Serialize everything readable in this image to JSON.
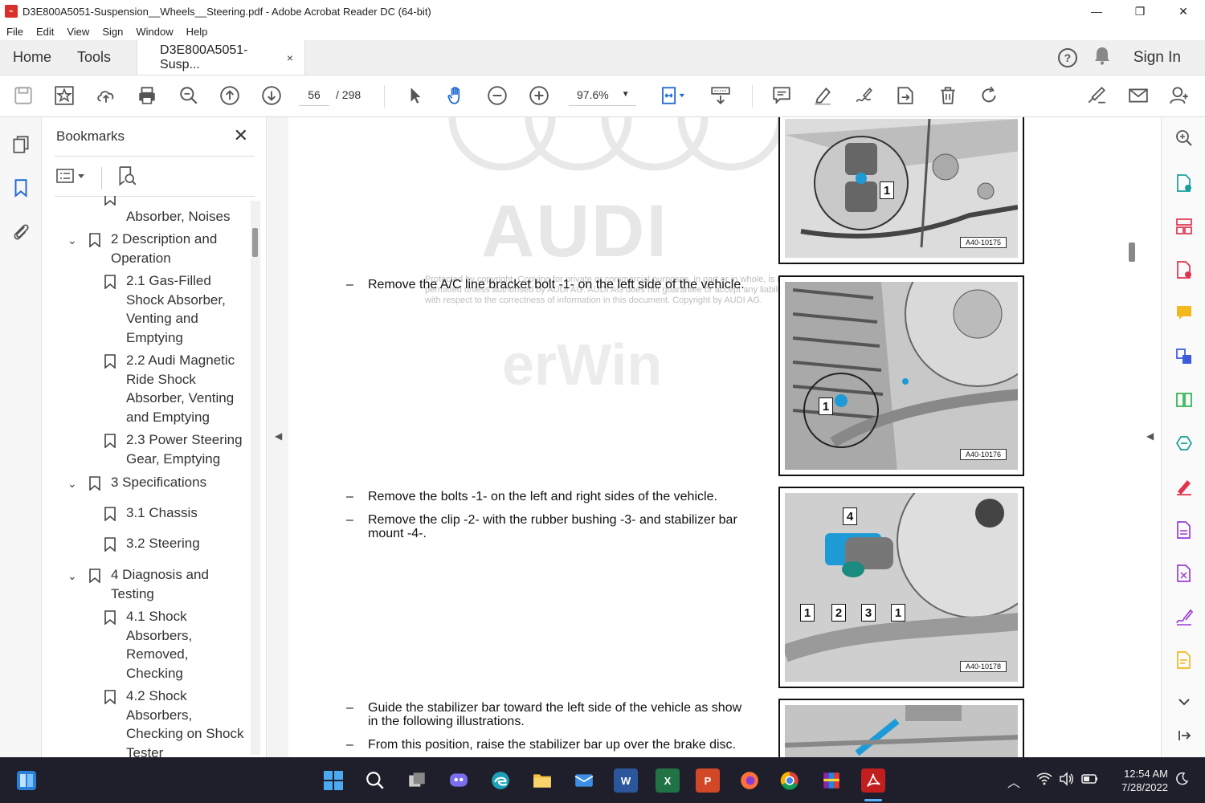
{
  "window": {
    "title": "D3E800A5051-Suspension__Wheels__Steering.pdf - Adobe Acrobat Reader DC (64-bit)",
    "minimize": "—",
    "restore": "❐",
    "close": "✕"
  },
  "menu": [
    "File",
    "Edit",
    "View",
    "Sign",
    "Window",
    "Help"
  ],
  "tabs": {
    "home": "Home",
    "tools": "Tools",
    "document": "D3E800A5051-Susp...",
    "close": "×",
    "sign_in": "Sign In"
  },
  "toolbar": {
    "page_current": "56",
    "page_total": "/  298",
    "zoom": "97.6%"
  },
  "bookmarks": {
    "title": "Bookmarks",
    "close": "✕",
    "items": [
      {
        "label": "Absorber, Noises",
        "level": 2
      },
      {
        "label": "2 Description and Operation",
        "level": 1,
        "expanded": true
      },
      {
        "label": "2.1 Gas-Filled Shock Absorber, Venting and Emptying",
        "level": 2
      },
      {
        "label": "2.2 Audi Magnetic Ride Shock Absorber, Venting and Emptying",
        "level": 2
      },
      {
        "label": "2.3 Power Steering Gear, Emptying",
        "level": 2
      },
      {
        "label": "3 Specifications",
        "level": 1,
        "expanded": true
      },
      {
        "label": "3.1 Chassis",
        "level": 2
      },
      {
        "label": "3.2 Steering",
        "level": 2
      },
      {
        "label": "4 Diagnosis and Testing",
        "level": 1,
        "expanded": true
      },
      {
        "label": "4.1 Shock Absorbers, Removed, Checking",
        "level": 2
      },
      {
        "label": "4.2 Shock Absorbers, Checking on Shock Tester",
        "level": 2
      }
    ]
  },
  "document": {
    "watermark_brand": "AUDI",
    "watermark_erwin": "erWin",
    "copyright": "Protected by copyright. Copying for private or commercial purposes, in part or in whole, is not permitted unless authorised by AUDI AG. AUDI AG does not guarantee or accept any liability with respect to the correctness of information in this document. Copyright by AUDI AG.",
    "steps": [
      "Remove the A/C line bracket bolt -1- on the left side of the vehicle.",
      "Remove the bolts -1- on the left and right sides of the vehicle.",
      "Remove the clip -2- with the rubber bushing -3- and stabilizer bar mount -4-.",
      "Guide the stabilizer bar toward the left side of the vehicle as show in the following illustrations.",
      "From this position, raise the stabilizer bar up over the brake disc."
    ],
    "dash": "–",
    "figures": [
      {
        "code": "A40-10175",
        "callouts": [
          "1"
        ]
      },
      {
        "code": "A40-10176",
        "callouts": [
          "1"
        ]
      },
      {
        "code": "A40-10178",
        "callouts": [
          "4",
          "1",
          "2",
          "3",
          "1"
        ]
      },
      {
        "code": ""
      }
    ]
  },
  "taskbar": {
    "time": "12:54 AM",
    "date": "7/28/2022"
  }
}
